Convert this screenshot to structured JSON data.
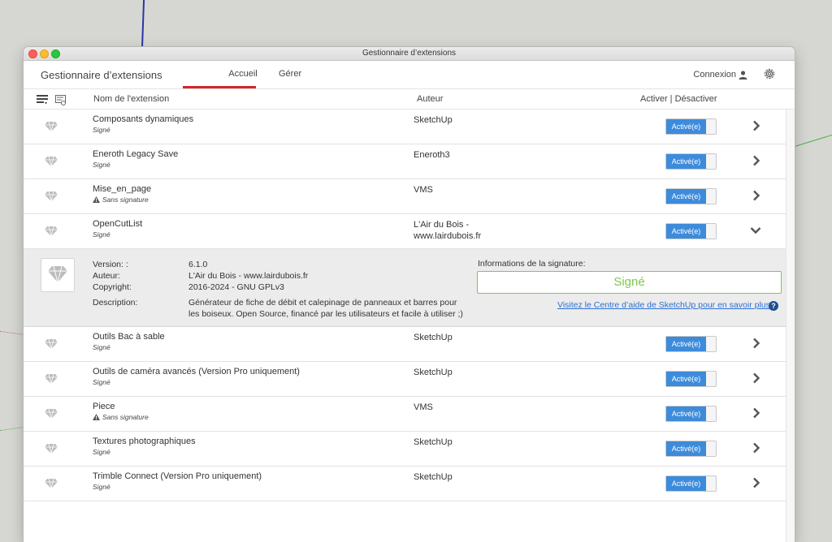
{
  "window": {
    "title": "Gestionnaire d’extensions"
  },
  "header": {
    "app_title": "Gestionnaire d’extensions",
    "tabs": [
      {
        "label": "Accueil",
        "active": true
      },
      {
        "label": "Gérer",
        "active": false
      }
    ],
    "login_label": "Connexion"
  },
  "columns": {
    "name": "Nom de l'extension",
    "author": "Auteur",
    "toggle": "Activer | Désactiver"
  },
  "toggle_label": "Activé(e)",
  "extensions": [
    {
      "name": "Composants dynamiques",
      "status": "Signé",
      "author": "SketchUp",
      "warning": false
    },
    {
      "name": "Eneroth Legacy Save",
      "status": "Signé",
      "author": "Eneroth3",
      "warning": false
    },
    {
      "name": "Mise_en_page",
      "status": "Sans signature",
      "author": "VMS",
      "warning": true
    },
    {
      "name": "OpenCutList",
      "status": "Signé",
      "author": "L'Air du Bois -",
      "author_line2": "www.lairdubois.fr",
      "warning": false,
      "expanded": true
    },
    {
      "name": "Outils Bac à sable",
      "status": "Signé",
      "author": "SketchUp",
      "warning": false
    },
    {
      "name": "Outils de caméra avancés (Version Pro uniquement)",
      "status": "Signé",
      "author": "SketchUp",
      "warning": false
    },
    {
      "name": "Piece",
      "status": "Sans signature",
      "author": "VMS",
      "warning": true
    },
    {
      "name": "Textures photographiques",
      "status": "Signé",
      "author": "SketchUp",
      "warning": false
    },
    {
      "name": "Trimble Connect (Version Pro uniquement)",
      "status": "Signé",
      "author": "SketchUp",
      "warning": false
    }
  ],
  "details": {
    "version_label": "Version: :",
    "version_value": "6.1.0",
    "author_label": "Auteur:",
    "author_value": "L'Air du Bois - www.lairdubois.fr",
    "copyright_label": "Copyright:",
    "copyright_value": "2016-2024 - GNU GPLv3",
    "description_label": "Description:",
    "description_line1": "Générateur de fiche de débit et calepinage de panneaux et barres pour",
    "description_line2": "les boiseux. Open Source, financé par les utilisateurs et facile à utiliser ;)",
    "signature_title": "Informations de la signature:",
    "signature_value": "Signé",
    "help_link": "Visitez le Centre d’aide de SketchUp pour en savoir plus",
    "help_icon": "?"
  },
  "colors": {
    "accent_blue": "#3d8bdb",
    "tab_red": "#d2262b",
    "signed_green": "#7cc94f",
    "link_blue": "#2c6fd0"
  }
}
